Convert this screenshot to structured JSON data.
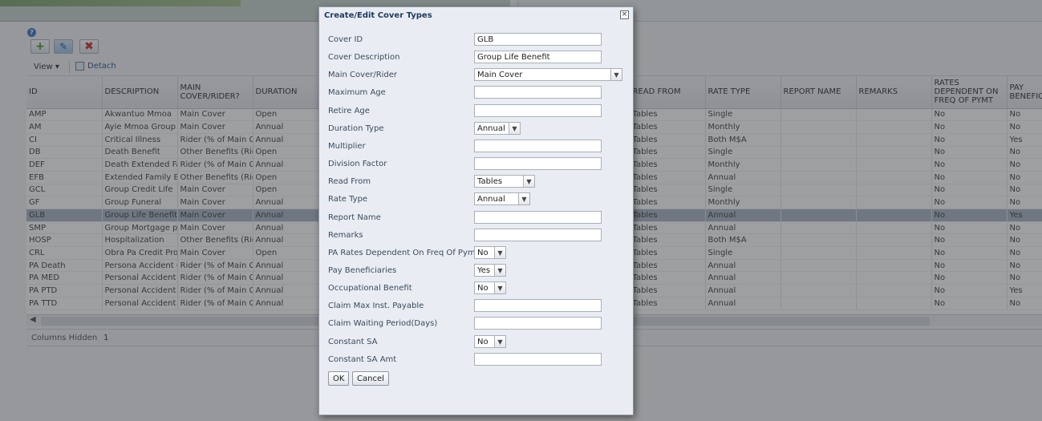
{
  "toolbar": {
    "help": "?",
    "view_label": "View ▾",
    "detach_label": "Detach"
  },
  "grid": {
    "columns": [
      "ID",
      "DESCRIPTION",
      "MAIN COVER/RIDER?",
      "DURATION",
      "",
      "",
      "",
      "",
      "READ FROM",
      "RATE TYPE",
      "REPORT NAME",
      "REMARKS",
      "RATES DEPENDENT ON FREQ OF PYMT",
      "PAY BENEFIC"
    ],
    "rows": [
      {
        "id": "AMP",
        "desc": "Akwantuo Mmoa",
        "main": "Main Cover",
        "dur": "Open",
        "read": "Tables",
        "rate": "Single",
        "dep": "No",
        "pay": "No"
      },
      {
        "id": "AM",
        "desc": "Ayie Mmoa Group",
        "main": "Main Cover",
        "dur": "Annual",
        "read": "Tables",
        "rate": "Monthly",
        "dep": "No",
        "pay": "No"
      },
      {
        "id": "CI",
        "desc": "Critical Illness",
        "main": "Rider (% of Main Co",
        "dur": "Annual",
        "read": "Tables",
        "rate": "Both M$A",
        "dep": "No",
        "pay": "Yes"
      },
      {
        "id": "DB",
        "desc": "Death Benefit",
        "main": "Other Benefits (Rider",
        "dur": "Open",
        "read": "Tables",
        "rate": "Single",
        "dep": "No",
        "pay": "No"
      },
      {
        "id": "DEF",
        "desc": "Death Extended Fam",
        "main": "Rider (% of Main Co",
        "dur": "Annual",
        "read": "Tables",
        "rate": "Monthly",
        "dep": "No",
        "pay": "No"
      },
      {
        "id": "EFB",
        "desc": "Extended Family Ber",
        "main": "Other Benefits (Rider",
        "dur": "Open",
        "read": "Tables",
        "rate": "Annual",
        "dep": "No",
        "pay": "No"
      },
      {
        "id": "GCL",
        "desc": "Group Credit Life",
        "main": "Main Cover",
        "dur": "Open",
        "read": "Tables",
        "rate": "Single",
        "dep": "No",
        "pay": "No"
      },
      {
        "id": "GF",
        "desc": "Group Funeral",
        "main": "Main Cover",
        "dur": "Annual",
        "read": "Tables",
        "rate": "Monthly",
        "dep": "No",
        "pay": "No"
      },
      {
        "id": "GLB",
        "desc": "Group Life Benefit",
        "main": "Main Cover",
        "dur": "Annual",
        "read": "Tables",
        "rate": "Annual",
        "dep": "No",
        "pay": "Yes"
      },
      {
        "id": "SMP",
        "desc": "Group Mortgage prc",
        "main": "Main Cover",
        "dur": "Annual",
        "read": "Tables",
        "rate": "Annual",
        "dep": "No",
        "pay": "No"
      },
      {
        "id": "HOSP",
        "desc": "Hospitalization",
        "main": "Other Benefits (Rider",
        "dur": "Annual",
        "read": "Tables",
        "rate": "Both M$A",
        "dep": "No",
        "pay": "No"
      },
      {
        "id": "CRL",
        "desc": "Obra Pa Credit Prote",
        "main": "Main Cover",
        "dur": "Open",
        "read": "Tables",
        "rate": "Single",
        "dep": "No",
        "pay": "No"
      },
      {
        "id": "PA Death",
        "desc": "Persona Accident (D",
        "main": "Rider (% of Main Co",
        "dur": "Annual",
        "read": "Tables",
        "rate": "Annual",
        "dep": "No",
        "pay": "No"
      },
      {
        "id": "PA MED",
        "desc": "Personal Accident (M",
        "main": "Rider (% of Main Co",
        "dur": "Annual",
        "read": "Tables",
        "rate": "Annual",
        "dep": "No",
        "pay": "No"
      },
      {
        "id": "PA PTD",
        "desc": "Personal Accident (P",
        "main": "Rider (% of Main Co",
        "dur": "Annual",
        "read": "Tables",
        "rate": "Annual",
        "dep": "No",
        "pay": "Yes"
      },
      {
        "id": "PA TTD",
        "desc": "Personal Accident (T",
        "main": "Rider (% of Main Co",
        "dur": "Annual",
        "read": "Tables",
        "rate": "Annual",
        "dep": "No",
        "pay": "No"
      }
    ],
    "selected_index": 8
  },
  "status": {
    "columns_hidden_label": "Columns Hidden",
    "columns_hidden_value": "1"
  },
  "dialog": {
    "title": "Create/Edit Cover Types",
    "close": "×",
    "fields": {
      "cover_id": {
        "label": "Cover ID",
        "value": "GLB"
      },
      "cover_desc": {
        "label": "Cover Description",
        "value": "Group Life Benefit"
      },
      "main_cover": {
        "label": "Main Cover/Rider",
        "value": "Main Cover"
      },
      "max_age": {
        "label": "Maximum Age",
        "value": ""
      },
      "retire_age": {
        "label": "Retire Age",
        "value": ""
      },
      "duration_type": {
        "label": "Duration Type",
        "value": "Annual"
      },
      "multiplier": {
        "label": "Multiplier",
        "value": ""
      },
      "division_factor": {
        "label": "Division Factor",
        "value": ""
      },
      "read_from": {
        "label": "Read From",
        "value": "Tables"
      },
      "rate_type": {
        "label": "Rate Type",
        "value": "Annual"
      },
      "report_name": {
        "label": "Report Name",
        "value": ""
      },
      "remarks": {
        "label": "Remarks",
        "value": ""
      },
      "pa_rates": {
        "label": "PA Rates Dependent On Freq Of Pymt",
        "value": "No"
      },
      "pay_benef": {
        "label": "Pay Beneficiaries",
        "value": "Yes"
      },
      "occ_benefit": {
        "label": "Occupational Benefit",
        "value": "No"
      },
      "claim_max": {
        "label": "Claim Max Inst. Payable",
        "value": ""
      },
      "claim_wait": {
        "label": "Claim Waiting Period(Days)",
        "value": ""
      },
      "constant_sa": {
        "label": "Constant SA",
        "value": "No"
      },
      "constant_sa_amt": {
        "label": "Constant SA Amt",
        "value": ""
      }
    },
    "ok_label": "OK",
    "cancel_label": "Cancel"
  }
}
